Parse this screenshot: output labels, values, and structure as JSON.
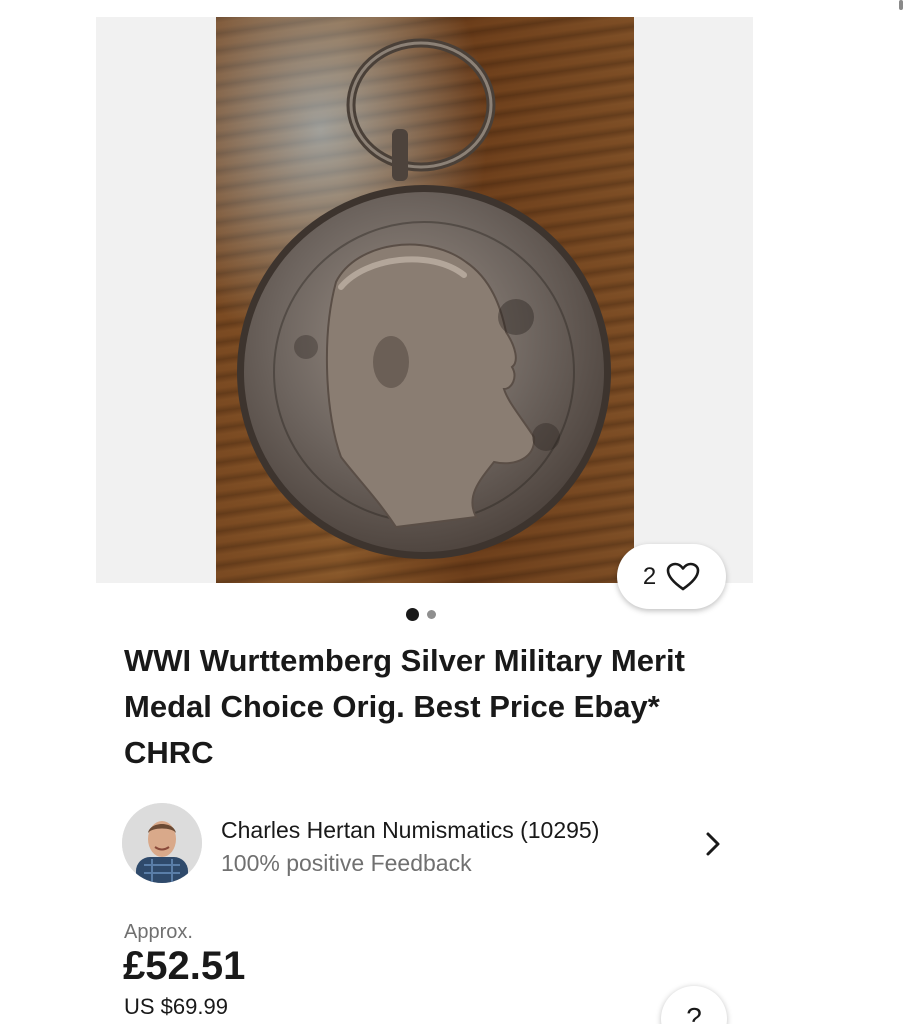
{
  "gallery": {
    "image_alt_icon": "medal-photo",
    "watch_count": "2",
    "page_indicator": {
      "current": 1,
      "total": 2
    }
  },
  "listing": {
    "title": "WWI Wurttemberg Silver Military Merit Medal Choice Orig. Best Price Ebay* CHRC"
  },
  "seller": {
    "name": "Charles Hertan Numismatics (10295)",
    "feedback": "100% positive Feedback"
  },
  "pricing": {
    "approx_label": "Approx.",
    "price": "£52.51",
    "usd_price": "US $69.99"
  },
  "help": {
    "label": "?"
  },
  "colors": {
    "text": "#191919",
    "muted": "#707070",
    "gallery_bg": "#f1f1f1"
  }
}
